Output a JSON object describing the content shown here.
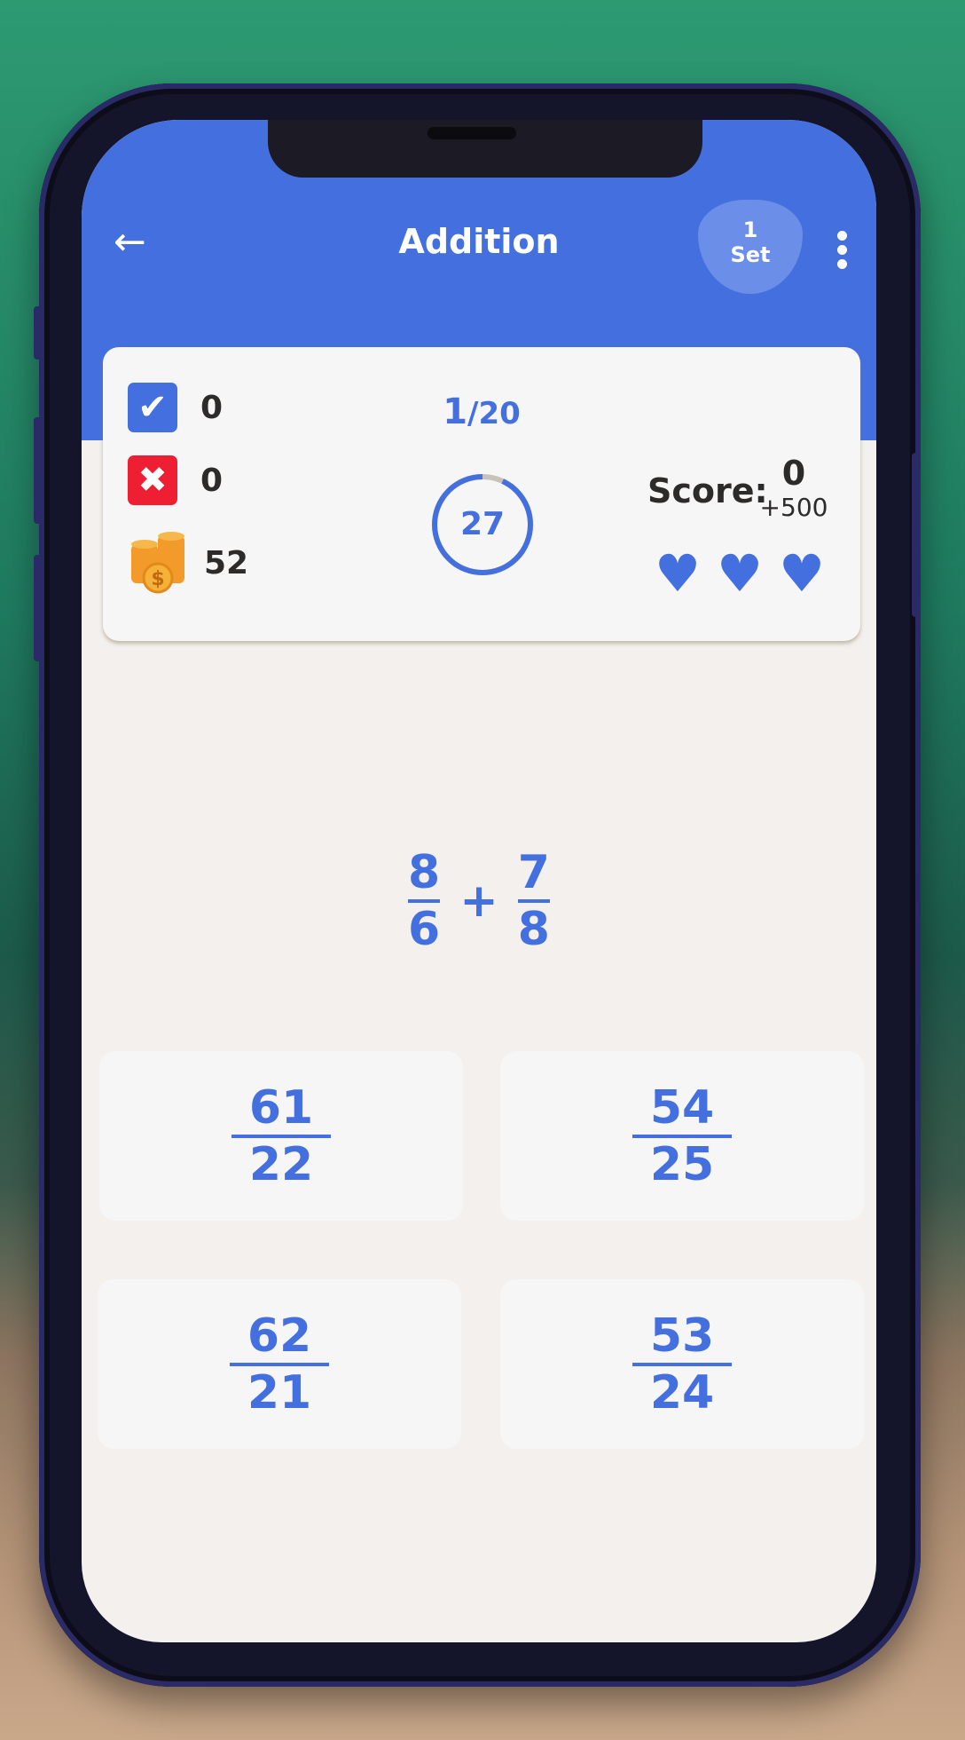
{
  "header": {
    "title": "Addition",
    "back_icon": "arrow-left-icon",
    "set_badge": {
      "number": "1",
      "label": "Set"
    },
    "menu_icon": "more-vertical-icon"
  },
  "stats": {
    "correct": "0",
    "wrong": "0",
    "coins": "52"
  },
  "progress": {
    "current": "1",
    "total": "/20"
  },
  "timer": {
    "value": "27",
    "remaining_fraction": 0.93
  },
  "score": {
    "label": "Score:",
    "value": "0",
    "bonus": "+500"
  },
  "lives": 3,
  "question": {
    "a": {
      "num": "8",
      "den": "6"
    },
    "op": "+",
    "b": {
      "num": "7",
      "den": "8"
    }
  },
  "answers": [
    {
      "num": "61",
      "den": "22"
    },
    {
      "num": "54",
      "den": "25"
    },
    {
      "num": "62",
      "den": "21"
    },
    {
      "num": "53",
      "den": "24"
    }
  ],
  "colors": {
    "primary": "#4470df",
    "wrong": "#ef1f33",
    "background": "#f3f0ee"
  }
}
